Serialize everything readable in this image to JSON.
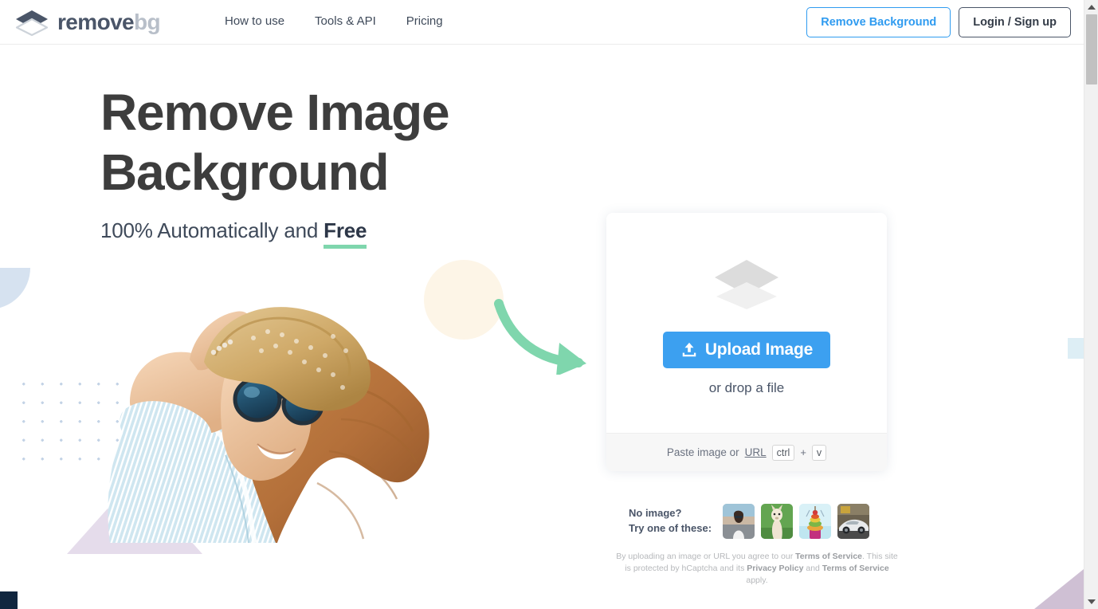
{
  "header": {
    "logo": {
      "word1": "remove",
      "word2": "bg",
      "icon": "layers-logo-icon"
    },
    "nav": [
      {
        "label": "How to use"
      },
      {
        "label": "Tools & API"
      },
      {
        "label": "Pricing"
      }
    ],
    "buttons": {
      "remove_background": "Remove Background",
      "login_signup": "Login / Sign up"
    }
  },
  "hero": {
    "title_line1": "Remove Image",
    "title_line2": "Background",
    "subtitle_prefix": "100% Automatically and ",
    "subtitle_highlight": "Free",
    "photo_alt": "woman-with-straw-hat-and-sunglasses"
  },
  "upload": {
    "stack_icon": "layers-stack-icon",
    "button_label": "Upload Image",
    "button_icon": "upload-icon",
    "drop_text": "or drop a file",
    "paste_prefix": "Paste image or",
    "paste_link": "URL",
    "key_ctrl": "ctrl",
    "key_plus": "+",
    "key_v": "v"
  },
  "samples": {
    "label_line1": "No image?",
    "label_line2": "Try one of these:",
    "thumbnails": [
      {
        "name": "sample-woman-sunglasses"
      },
      {
        "name": "sample-alpaca"
      },
      {
        "name": "sample-colorful-toy"
      },
      {
        "name": "sample-white-sports-car"
      }
    ]
  },
  "legal": {
    "part1": "By uploading an image or URL you agree to our ",
    "bold1": "Terms of Service",
    "part2": ". This site is protected by hCaptcha and its ",
    "bold2": "Privacy Policy",
    "part3": " and ",
    "bold3": "Terms of Service",
    "part4": " apply."
  },
  "colors": {
    "accent_blue": "#3ca0f0",
    "link_blue": "#2f9bf0",
    "heading": "#3d3d3d",
    "body_text": "#3f4a5a",
    "underline_green": "#7fd6ad",
    "arrow_green": "#7fd6ad",
    "circle_cream": "#fdf5e7",
    "quarter_blue": "#d6e2f0",
    "triangle_purple": "#e5dceb",
    "corner_purple": "#cfc0d4",
    "navy_square": "#10263f",
    "logo_dark": "#4a5568",
    "logo_light": "#b8bfc9"
  },
  "scrollbar": {
    "up_arrow": "scroll-up-arrow",
    "down_arrow": "scroll-down-arrow",
    "thumb": "scroll-thumb"
  }
}
